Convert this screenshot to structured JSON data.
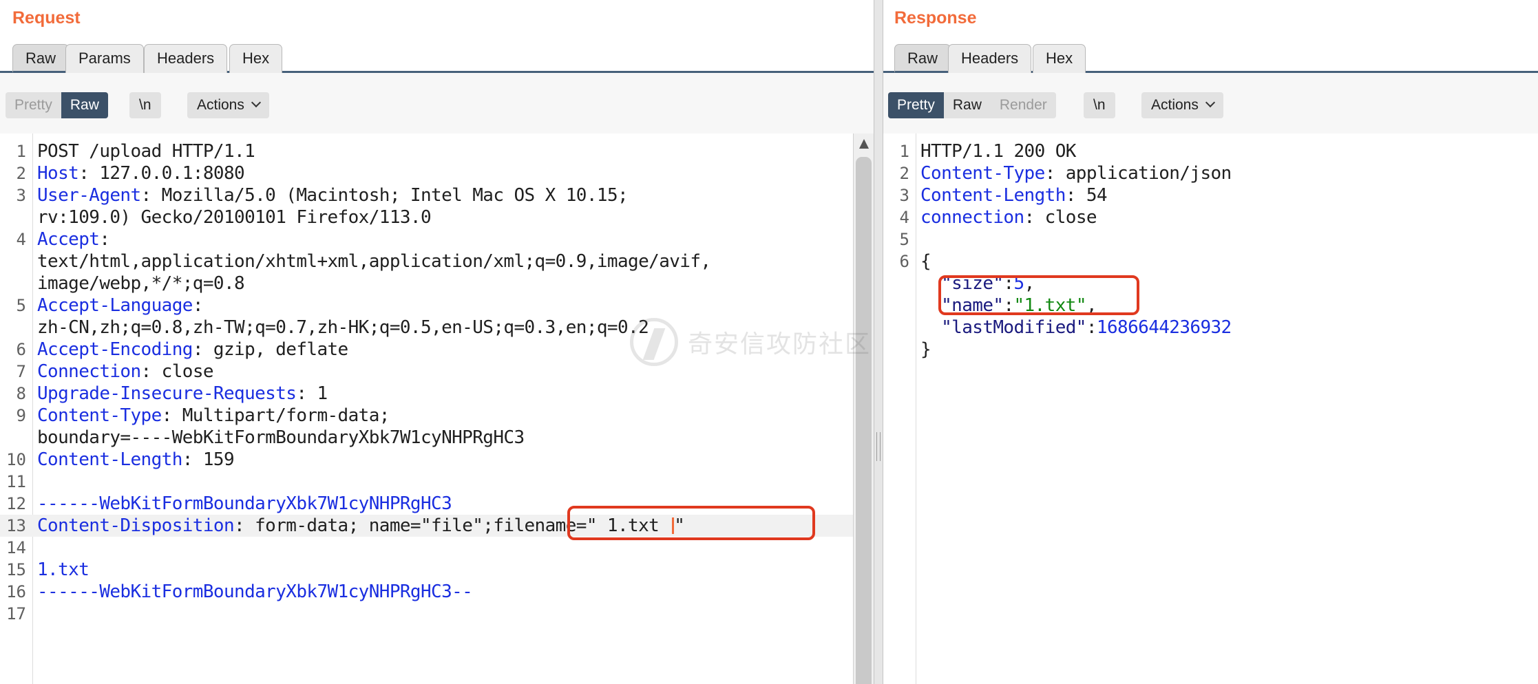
{
  "request": {
    "title": "Request",
    "tabs": [
      "Raw",
      "Params",
      "Headers",
      "Hex"
    ],
    "active_tab": "Raw",
    "view_modes": [
      "Pretty",
      "Raw"
    ],
    "active_view_mode": "Raw",
    "newline_label": "\\n",
    "actions_label": "Actions",
    "lines": [
      {
        "n": "1",
        "key": "",
        "val": "POST /upload HTTP/1.1"
      },
      {
        "n": "2",
        "key": "Host",
        "val": ": 127.0.0.1:8080"
      },
      {
        "n": "3",
        "key": "User-Agent",
        "val": ": Mozilla/5.0 (Macintosh; Intel Mac OS X 10.15;"
      },
      {
        "n": "",
        "key": "",
        "val": "rv:109.0) Gecko/20100101 Firefox/113.0"
      },
      {
        "n": "4",
        "key": "Accept",
        "val": ":"
      },
      {
        "n": "",
        "key": "",
        "val": "text/html,application/xhtml+xml,application/xml;q=0.9,image/avif,"
      },
      {
        "n": "",
        "key": "",
        "val": "image/webp,*/*;q=0.8"
      },
      {
        "n": "5",
        "key": "Accept-Language",
        "val": ":"
      },
      {
        "n": "",
        "key": "",
        "val": "zh-CN,zh;q=0.8,zh-TW;q=0.7,zh-HK;q=0.5,en-US;q=0.3,en;q=0.2"
      },
      {
        "n": "6",
        "key": "Accept-Encoding",
        "val": ": gzip, deflate"
      },
      {
        "n": "7",
        "key": "Connection",
        "val": ": close"
      },
      {
        "n": "8",
        "key": "Upgrade-Insecure-Requests",
        "val": ": 1"
      },
      {
        "n": "9",
        "key": "Content-Type",
        "val": ": Multipart/form-data;"
      },
      {
        "n": "",
        "key": "",
        "val": "boundary=----WebKitFormBoundaryXbk7W1cyNHPRgHC3"
      },
      {
        "n": "10",
        "key": "Content-Length",
        "val": ": 159"
      },
      {
        "n": "11",
        "key": "",
        "val": ""
      },
      {
        "n": "12",
        "key": "",
        "val": "------WebKitFormBoundaryXbk7W1cyNHPRgHC3",
        "style": "bnd"
      },
      {
        "n": "13",
        "key": "Content-Disposition",
        "val": ": form-data; name=\"file\";filename=\" 1.txt ",
        "tail": "\"",
        "highlight": true
      },
      {
        "n": "14",
        "key": "",
        "val": ""
      },
      {
        "n": "15",
        "key": "",
        "val": "1.txt",
        "style": "body-blue"
      },
      {
        "n": "16",
        "key": "",
        "val": "------WebKitFormBoundaryXbk7W1cyNHPRgHC3--",
        "style": "bnd"
      },
      {
        "n": "17",
        "key": "",
        "val": ""
      }
    ]
  },
  "response": {
    "title": "Response",
    "tabs": [
      "Raw",
      "Headers",
      "Hex"
    ],
    "active_tab": "Raw",
    "view_modes": [
      "Pretty",
      "Raw",
      "Render"
    ],
    "active_view_mode": "Pretty",
    "newline_label": "\\n",
    "actions_label": "Actions",
    "lines": [
      {
        "n": "1",
        "key": "",
        "val": "HTTP/1.1 200 OK"
      },
      {
        "n": "2",
        "key": "Content-Type",
        "val": ": application/json"
      },
      {
        "n": "3",
        "key": "Content-Length",
        "val": ": 54"
      },
      {
        "n": "4",
        "key": "connection",
        "val": ": close"
      },
      {
        "n": "5",
        "key": "",
        "val": ""
      },
      {
        "n": "6",
        "key": "",
        "val": "{"
      },
      {
        "n": "",
        "jkey": "  \"size\"",
        "colon": ":",
        "jval": "5",
        "jtype": "num",
        "trail": ","
      },
      {
        "n": "",
        "jkey": "  \"name\"",
        "colon": ":",
        "jval": "\"1.txt\"",
        "jtype": "str",
        "trail": ","
      },
      {
        "n": "",
        "jkey": "  \"lastModified\"",
        "colon": ":",
        "jval": "1686644236932",
        "jtype": "num",
        "trail": ""
      },
      {
        "n": "",
        "key": "",
        "val": "}"
      }
    ]
  },
  "watermark": "奇安信攻防社区",
  "colors": {
    "title_orange": "#f26b3a",
    "header_key_blue": "#1a2ee0",
    "active_toggle": "#3c5168",
    "annotation_red": "#e0391f",
    "json_string_green": "#118811"
  }
}
